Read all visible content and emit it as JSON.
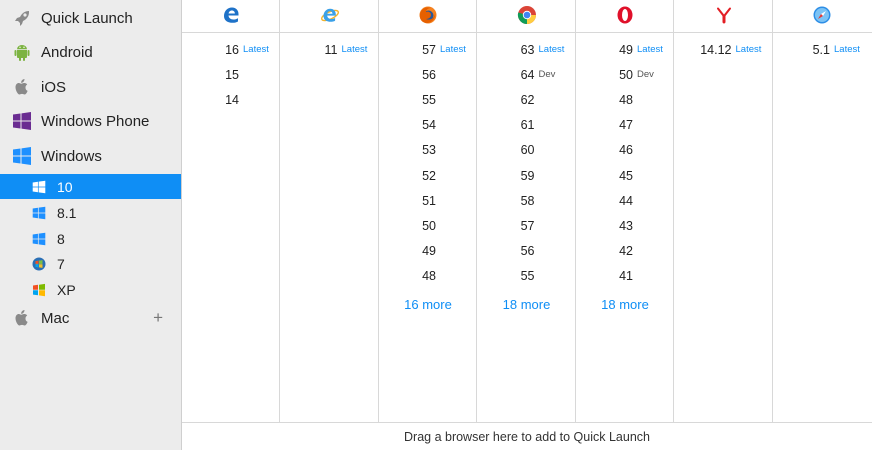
{
  "sidebar": {
    "os": [
      {
        "label": "Quick Launch",
        "icon": "rocket-icon"
      },
      {
        "label": "Android",
        "icon": "android-icon"
      },
      {
        "label": "iOS",
        "icon": "apple-icon"
      },
      {
        "label": "Windows Phone",
        "icon": "windows-phone-icon"
      },
      {
        "label": "Windows",
        "icon": "windows-icon"
      }
    ],
    "windows_versions": [
      {
        "label": "10",
        "icon": "windows-10-icon"
      },
      {
        "label": "8.1",
        "icon": "windows-8-icon"
      },
      {
        "label": "8",
        "icon": "windows-8-icon"
      },
      {
        "label": "7",
        "icon": "windows-7-icon"
      },
      {
        "label": "XP",
        "icon": "windows-xp-icon"
      }
    ],
    "mac": {
      "label": "Mac",
      "icon": "apple-icon",
      "add_label": "+"
    },
    "selected_color": "#0f8ef5"
  },
  "browsers": [
    {
      "name": "edge",
      "icon": "edge-icon",
      "versions": [
        {
          "v": "16",
          "tag": "Latest"
        },
        {
          "v": "15"
        },
        {
          "v": "14"
        }
      ]
    },
    {
      "name": "internet-explorer",
      "icon": "internet-explorer-icon",
      "versions": [
        {
          "v": "11",
          "tag": "Latest"
        }
      ]
    },
    {
      "name": "firefox",
      "icon": "firefox-icon",
      "versions": [
        {
          "v": "57",
          "tag": "Latest"
        },
        {
          "v": "56"
        },
        {
          "v": "55"
        },
        {
          "v": "54"
        },
        {
          "v": "53"
        },
        {
          "v": "52"
        },
        {
          "v": "51"
        },
        {
          "v": "50"
        },
        {
          "v": "49"
        },
        {
          "v": "48"
        }
      ],
      "more": "16 more"
    },
    {
      "name": "chrome",
      "icon": "chrome-icon",
      "versions": [
        {
          "v": "63",
          "tag": "Latest"
        },
        {
          "v": "64",
          "tag": "Dev"
        },
        {
          "v": "62"
        },
        {
          "v": "61"
        },
        {
          "v": "60"
        },
        {
          "v": "59"
        },
        {
          "v": "58"
        },
        {
          "v": "57"
        },
        {
          "v": "56"
        },
        {
          "v": "55"
        }
      ],
      "more": "18 more"
    },
    {
      "name": "opera",
      "icon": "opera-icon",
      "versions": [
        {
          "v": "49",
          "tag": "Latest"
        },
        {
          "v": "50",
          "tag": "Dev"
        },
        {
          "v": "48"
        },
        {
          "v": "47"
        },
        {
          "v": "46"
        },
        {
          "v": "45"
        },
        {
          "v": "44"
        },
        {
          "v": "43"
        },
        {
          "v": "42"
        },
        {
          "v": "41"
        }
      ],
      "more": "18 more"
    },
    {
      "name": "yandex",
      "icon": "yandex-icon",
      "versions": [
        {
          "v": "14.12",
          "tag": "Latest"
        }
      ]
    },
    {
      "name": "safari",
      "icon": "safari-icon",
      "versions": [
        {
          "v": "5.1",
          "tag": "Latest"
        }
      ]
    }
  ],
  "footer": {
    "text": "Drag a browser here to add to Quick Launch"
  }
}
